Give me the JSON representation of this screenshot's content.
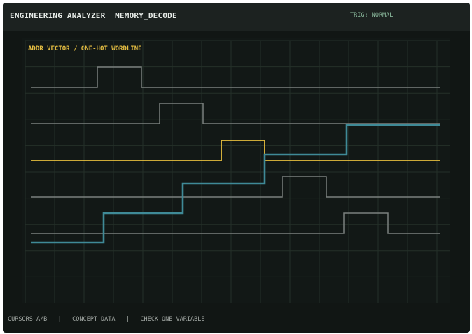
{
  "header": {
    "title": "ENGINEERING ANALYZER  MEMORY_DECODE",
    "trigger_status": "TRIG: NORMAL"
  },
  "plot": {
    "label": "ADDR VECTOR / ONE-HOT WORDLINE",
    "colors": {
      "wordline_idle": "#7b807e",
      "wordline_selected": "#e7bf3e",
      "address_vector": "#3f8a97",
      "grid": "#243029"
    },
    "grid": true,
    "wordlines": [
      {
        "pulse": [
          2,
          3
        ],
        "selected": false
      },
      {
        "pulse": [
          3,
          4
        ],
        "selected": false
      },
      {
        "pulse": [
          4,
          5
        ],
        "selected": true
      },
      {
        "pulse": [
          5,
          6
        ],
        "selected": false
      },
      {
        "pulse": [
          6,
          7
        ],
        "selected": false
      }
    ],
    "address_vector_steps": [
      {
        "from": 0,
        "to": 1,
        "level": 0
      },
      {
        "from": 1,
        "to": 2,
        "level": 1
      },
      {
        "from": 2,
        "to": 3,
        "level": 2
      },
      {
        "from": 3,
        "to": 4,
        "level": 3
      },
      {
        "from": 4,
        "to": 5,
        "level": 4
      }
    ]
  },
  "footer": {
    "text": "CURSORS A/B   |   CONCEPT DATA   |   CHECK ONE VARIABLE"
  }
}
